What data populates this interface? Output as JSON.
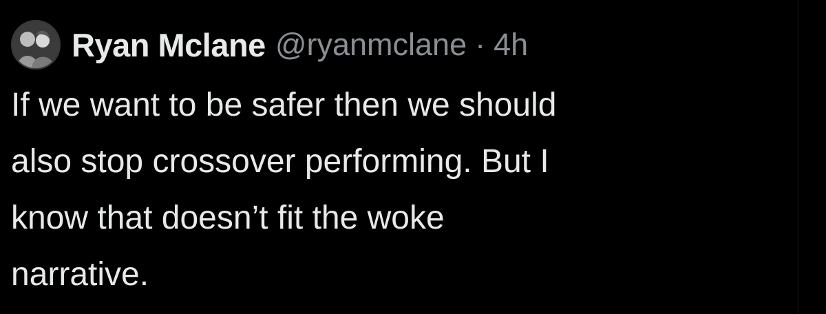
{
  "tweet": {
    "author": {
      "display_name": "Ryan Mclane",
      "handle": "@ryanmclane",
      "separator": "·",
      "time": "4h"
    },
    "text_lines": [
      "If we want to be safer then we should",
      "also stop crossover performing. But I",
      "know that doesn’t fit the woke",
      "narrative."
    ]
  },
  "colors": {
    "background": "#000000",
    "primary_text": "#e7e9ea",
    "secondary_text": "#8b8f93"
  },
  "icons": {
    "avatar": "profile-photo-avatar"
  }
}
